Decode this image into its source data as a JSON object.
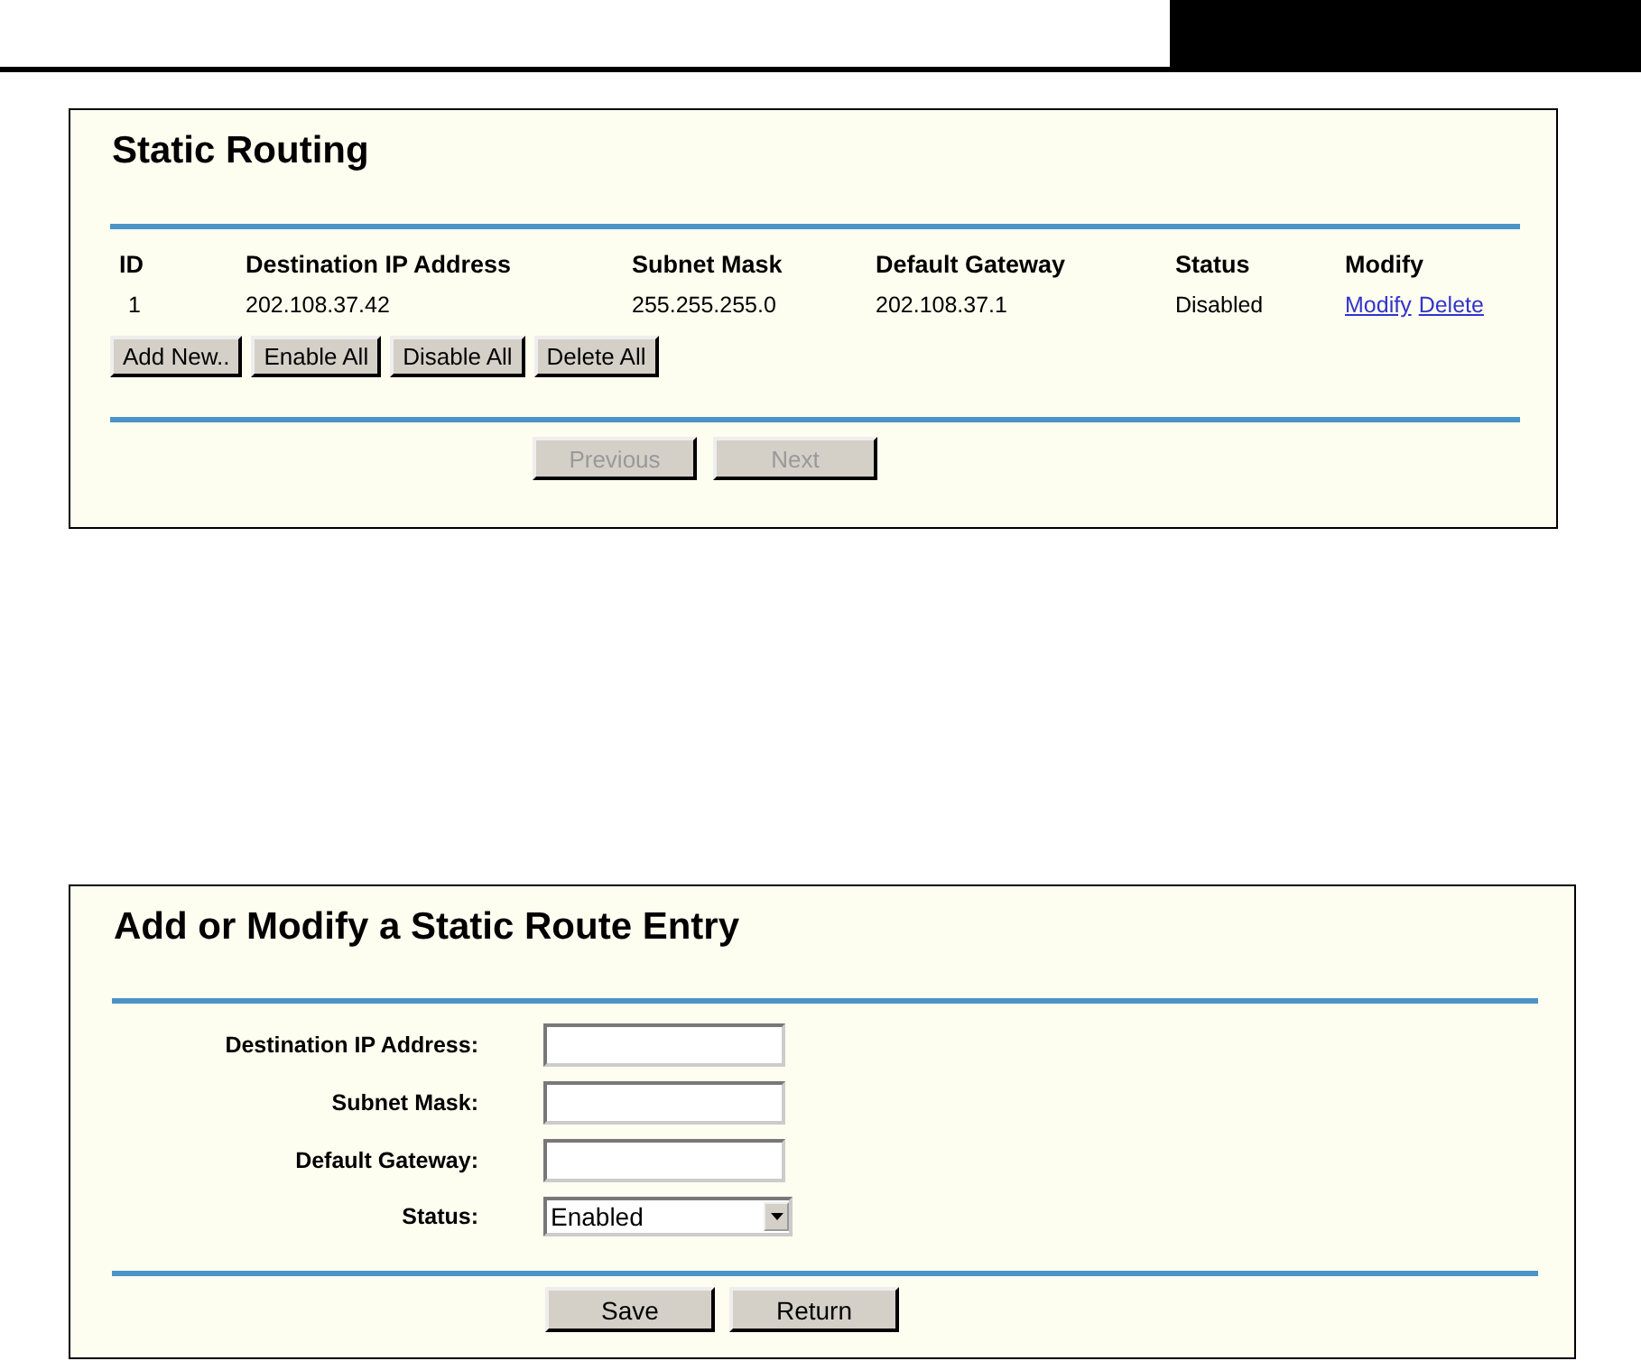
{
  "routing": {
    "title": "Static Routing",
    "columns": [
      "ID",
      "Destination IP Address",
      "Subnet Mask",
      "Default Gateway",
      "Status",
      "Modify"
    ],
    "rows": [
      {
        "cells": [
          "1",
          "202.108.37.42",
          "255.255.255.0",
          "202.108.37.1",
          "Disabled"
        ],
        "links": [
          "Modify",
          "Delete"
        ]
      }
    ],
    "buttons": [
      "Add New..",
      "Enable All",
      "Disable All",
      "Delete All"
    ],
    "pager": [
      {
        "label": "Previous",
        "disabled": true
      },
      {
        "label": "Next",
        "disabled": true
      }
    ]
  },
  "entry": {
    "title": "Add or Modify a Static Route Entry",
    "fields": [
      {
        "kind": "text",
        "label": "Destination IP Address:"
      },
      {
        "kind": "text",
        "label": "Subnet Mask:"
      },
      {
        "kind": "text",
        "label": "Default Gateway:"
      },
      {
        "kind": "select",
        "label": "Status:",
        "value": "Enabled"
      }
    ],
    "buttons": [
      "Save",
      "Return"
    ]
  }
}
